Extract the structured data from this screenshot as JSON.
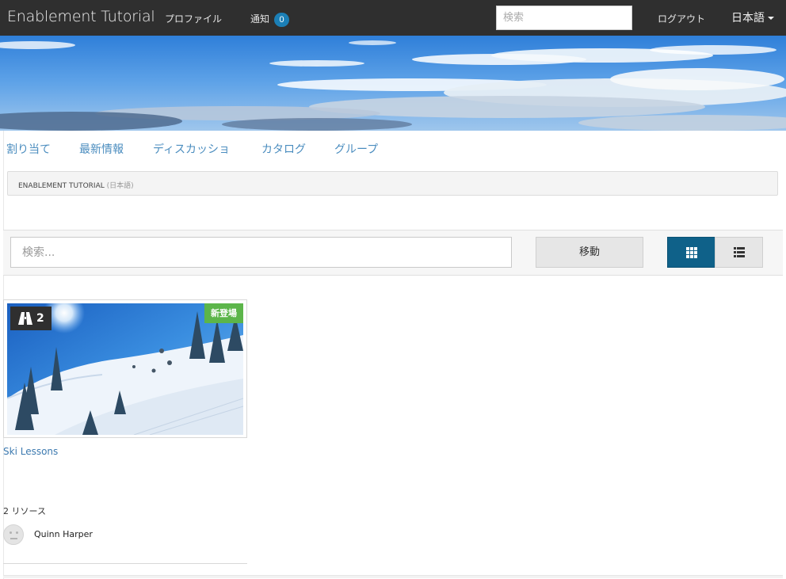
{
  "navbar": {
    "brand": "Enablement Tutorial",
    "profile": "プロファイル",
    "notifications": "通知",
    "notification_count": "0",
    "search_placeholder": "検索",
    "logout": "ログアウト",
    "language": "日本語"
  },
  "subnav": {
    "items": [
      "割り当て",
      "最新情報",
      "ディスカッショ",
      "カタログ",
      "グループ"
    ]
  },
  "breadcrumb": {
    "title": "ENABLEMENT TUTORIAL",
    "lang": "(日本語)"
  },
  "toolbar": {
    "search_placeholder": "検索...",
    "go_label": "移動",
    "view_modes": [
      "grid-view-icon",
      "list-view-icon"
    ],
    "active_view": "grid",
    "accent_color": "#0f6189"
  },
  "cards": [
    {
      "count": "2",
      "badge": "新登場",
      "badge_color": "#5cb54a",
      "title": "Ski Lessons",
      "resources": "2 リソース",
      "author": "Quinn Harper"
    }
  ]
}
